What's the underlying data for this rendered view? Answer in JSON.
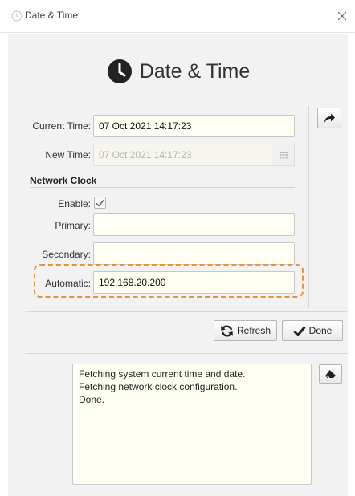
{
  "window": {
    "title": "Date & Time",
    "close_icon": "close-icon",
    "app_icon": "clock-icon"
  },
  "header": {
    "title": "Date & Time",
    "icon": "clock-icon"
  },
  "form": {
    "current_time": {
      "label": "Current Time:",
      "value": "07 Oct 2021 14:17:23"
    },
    "new_time": {
      "label": "New Time:",
      "value": "07 Oct 2021 14:17:23",
      "disabled": true,
      "icon": "calendar-icon"
    },
    "network_clock": {
      "title": "Network Clock",
      "enable": {
        "label": "Enable:",
        "checked": true
      },
      "primary": {
        "label": "Primary:",
        "value": ""
      },
      "secondary": {
        "label": "Secondary:",
        "value": ""
      },
      "automatic": {
        "label": "Automatic:",
        "value": "192.168.20.200"
      }
    },
    "apply_icon": "share-arrow-icon"
  },
  "buttons": {
    "refresh": {
      "label": "Refresh",
      "icon": "refresh-icon"
    },
    "done": {
      "label": "Done",
      "icon": "checkmark-icon"
    }
  },
  "log": {
    "lines": [
      "Fetching system current time and date.",
      "Fetching network clock configuration.",
      "Done."
    ],
    "clear_icon": "eraser-icon"
  },
  "colors": {
    "highlight": "#e8923a",
    "field_bg": "#fffff4",
    "panel_bg": "#f2f2f2"
  }
}
